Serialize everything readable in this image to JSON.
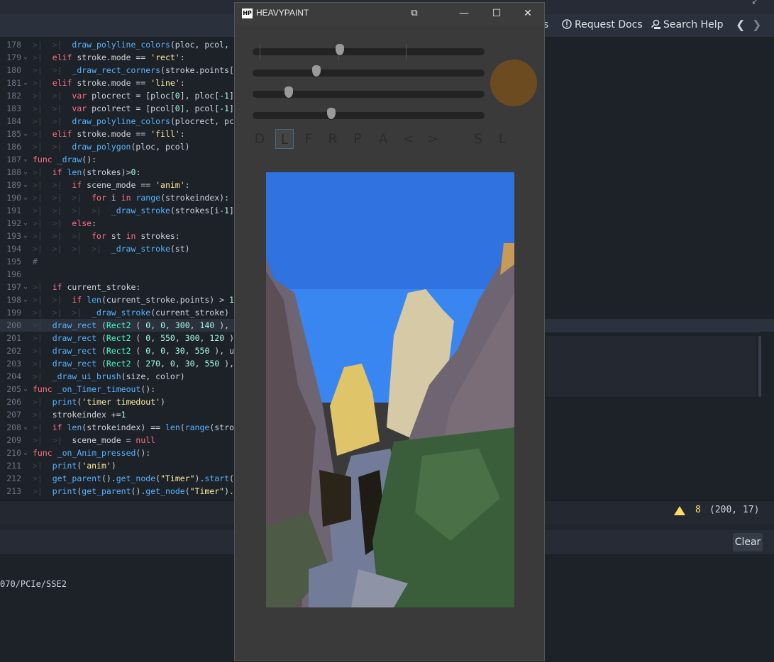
{
  "editor": {
    "toolbar": {
      "partial_label": "s",
      "request_docs": "Request Docs",
      "search_help": "Search Help",
      "prev": "❮",
      "next": "❯"
    },
    "code_lines": [
      {
        "n": "178",
        "fold": "",
        "html": "<span class='t-tab'>&gt;|  &gt;|  </span><span class='t-fn'>draw_polyline_colors</span>(ploc, pcol, "
      },
      {
        "n": "179",
        "fold": "⌄",
        "html": "<span class='t-tab'>&gt;|  </span><span class='t-kw'>elif</span> stroke.mode == <span class='t-str'>'rect'</span>:"
      },
      {
        "n": "180",
        "fold": "",
        "html": "<span class='t-tab'>&gt;|  &gt;|  </span><span class='t-fn'>_draw_rect_corners</span>(stroke.points["
      },
      {
        "n": "181",
        "fold": "⌄",
        "html": "<span class='t-tab'>&gt;|  </span><span class='t-kw'>elif</span> stroke.mode == <span class='t-str'>'line'</span>:"
      },
      {
        "n": "182",
        "fold": "",
        "html": "<span class='t-tab'>&gt;|  &gt;|  </span><span class='t-kw'>var</span> plocrect = [ploc[<span class='t-num'>0</span>], ploc[<span class='t-num'>-1</span>]"
      },
      {
        "n": "183",
        "fold": "",
        "html": "<span class='t-tab'>&gt;|  &gt;|  </span><span class='t-kw'>var</span> pcolrect = [pcol[<span class='t-num'>0</span>], pcol[<span class='t-num'>-1</span>]"
      },
      {
        "n": "184",
        "fold": "",
        "html": "<span class='t-tab'>&gt;|  &gt;|  </span><span class='t-fn'>draw_polyline_colors</span>(plocrect, pc"
      },
      {
        "n": "185",
        "fold": "⌄",
        "html": "<span class='t-tab'>&gt;|  </span><span class='t-kw'>elif</span> stroke.mode == <span class='t-str'>'fill'</span>:"
      },
      {
        "n": "186",
        "fold": "",
        "html": "<span class='t-tab'>&gt;|  &gt;|  </span><span class='t-fn'>draw_polygon</span>(ploc, pcol)"
      },
      {
        "n": "187",
        "fold": "⌄",
        "html": "<span class='t-kw'>func</span> <span class='t-fn'>_draw</span>():"
      },
      {
        "n": "188",
        "fold": "⌄",
        "html": "<span class='t-tab'>&gt;|  </span><span class='t-kw'>if</span> <span class='t-fn'>len</span>(strokes)&gt;<span class='t-num'>0</span>:"
      },
      {
        "n": "189",
        "fold": "⌄",
        "html": "<span class='t-tab'>&gt;|  &gt;|  </span><span class='t-kw'>if</span> scene_mode == <span class='t-str'>'anim'</span>:"
      },
      {
        "n": "190",
        "fold": "⌄",
        "html": "<span class='t-tab'>&gt;|  &gt;|  &gt;|  </span><span class='t-kw'>for</span> i <span class='t-kw'>in</span> <span class='t-fn'>range</span>(strokeindex):"
      },
      {
        "n": "191",
        "fold": "",
        "html": "<span class='t-tab'>&gt;|  &gt;|  &gt;|  &gt;|  </span><span class='t-fn'>_draw_stroke</span>(strokes[i-<span class='t-num'>1</span>]"
      },
      {
        "n": "192",
        "fold": "⌄",
        "html": "<span class='t-tab'>&gt;|  &gt;|  </span><span class='t-kw'>else</span>:"
      },
      {
        "n": "193",
        "fold": "⌄",
        "html": "<span class='t-tab'>&gt;|  &gt;|  &gt;|  </span><span class='t-kw'>for</span> st <span class='t-kw'>in</span> strokes:"
      },
      {
        "n": "194",
        "fold": "",
        "html": "<span class='t-tab'>&gt;|  &gt;|  &gt;|  &gt;|  </span><span class='t-fn'>_draw_stroke</span>(st)"
      },
      {
        "n": "195",
        "fold": "",
        "html": "<span class='t-cm'>#</span>"
      },
      {
        "n": "196",
        "fold": "",
        "html": ""
      },
      {
        "n": "197",
        "fold": "⌄",
        "html": "<span class='t-tab'>&gt;|  </span><span class='t-kw'>if</span> current_stroke:"
      },
      {
        "n": "198",
        "fold": "⌄",
        "html": "<span class='t-tab'>&gt;|  &gt;|  </span><span class='t-kw'>if</span> <span class='t-fn'>len</span>(current_stroke.points) &gt; <span class='t-num'>1</span>"
      },
      {
        "n": "199",
        "fold": "",
        "html": "<span class='t-tab'>&gt;|  &gt;|  &gt;|  </span><span class='t-fn'>_draw_stroke</span>(current_stroke)"
      },
      {
        "n": "200",
        "fold": "",
        "html": "<span class='t-tab'>&gt;|  </span><span class='t-fn'>draw_rect</span> (<span class='t-cls'>Rect2</span> ( <span class='t-num'>0</span>, <span class='t-num'>0</span>, <span class='t-num'>300</span>, <span class='t-num'>140</span> ),",
        "hl": true
      },
      {
        "n": "201",
        "fold": "",
        "html": "<span class='t-tab'>&gt;|  </span><span class='t-fn'>draw_rect</span> (<span class='t-cls'>Rect2</span> ( <span class='t-num'>0</span>, <span class='t-num'>550</span>, <span class='t-num'>300</span>, <span class='t-num'>120</span> ),"
      },
      {
        "n": "202",
        "fold": "",
        "html": "<span class='t-tab'>&gt;|  </span><span class='t-fn'>draw_rect</span> (<span class='t-cls'>Rect2</span> ( <span class='t-num'>0</span>, <span class='t-num'>0</span>, <span class='t-num'>30</span>, <span class='t-num'>550</span> ), u"
      },
      {
        "n": "203",
        "fold": "",
        "html": "<span class='t-tab'>&gt;|  </span><span class='t-fn'>draw_rect</span> (<span class='t-cls'>Rect2</span> ( <span class='t-num'>270</span>, <span class='t-num'>0</span>, <span class='t-num'>30</span>, <span class='t-num'>550</span> ),"
      },
      {
        "n": "204",
        "fold": "",
        "html": "<span class='t-tab'>&gt;|  </span><span class='t-fn'>_draw_ui_brush</span>(size, color)"
      },
      {
        "n": "205",
        "fold": "⌄",
        "html": "<span class='t-kw'>func</span> <span class='t-fn'>_on_Timer_timeout</span>():"
      },
      {
        "n": "206",
        "fold": "",
        "html": "<span class='t-tab'>&gt;|  </span><span class='t-fn'>print</span>(<span class='t-str'>'timer timedout'</span>)"
      },
      {
        "n": "207",
        "fold": "",
        "html": "<span class='t-tab'>&gt;|  </span>strokeindex +=<span class='t-num'>1</span>"
      },
      {
        "n": "208",
        "fold": "⌄",
        "html": "<span class='t-tab'>&gt;|  </span><span class='t-kw'>if</span> <span class='t-fn'>len</span>(strokeindex) == <span class='t-fn'>len</span>(<span class='t-fn'>range</span>(stro"
      },
      {
        "n": "209",
        "fold": "",
        "html": "<span class='t-tab'>&gt;|  &gt;|  </span>scene_mode = <span class='t-kw'>null</span>"
      },
      {
        "n": "210",
        "fold": "⌄",
        "html": "<span class='t-kw'>func</span> <span class='t-fn'>_on_Anim_pressed</span>():"
      },
      {
        "n": "211",
        "fold": "",
        "html": "<span class='t-tab'>&gt;|  </span><span class='t-fn'>print</span>(<span class='t-str'>'anim'</span>)"
      },
      {
        "n": "212",
        "fold": "",
        "html": "<span class='t-tab'>&gt;|  </span><span class='t-fn'>get_parent</span>().<span class='t-fn'>get_node</span>(<span class='t-str'>\"Timer\"</span>).<span class='t-fn'>start</span>("
      },
      {
        "n": "213",
        "fold": "",
        "html": "<span class='t-tab'>&gt;|  </span><span class='t-fn'>print</span>(<span class='t-fn'>get_parent</span>().<span class='t-fn'>get_node</span>(<span class='t-str'>\"Timer\"</span>)."
      }
    ],
    "status": {
      "warning_count": "8",
      "cursor_position": "(200, 17)"
    },
    "output": {
      "clear_label": "Clear",
      "text": "070/PCIe/SSE2"
    }
  },
  "heavypaint": {
    "logo": "HP",
    "title": "HEAVYPAINT",
    "window_buttons": {
      "restore": "⧉",
      "minimize": "—",
      "maximize": "☐",
      "close": "✕"
    },
    "sliders": [
      {
        "name": "slider-1",
        "value": 0.375
      },
      {
        "name": "slider-2",
        "value": 0.275
      },
      {
        "name": "slider-3",
        "value": 0.155
      },
      {
        "name": "slider-4",
        "value": 0.34
      }
    ],
    "brush_color": "#6d4b20",
    "tools": [
      {
        "label": "D",
        "active": false
      },
      {
        "label": "L",
        "active": true
      },
      {
        "label": "F",
        "active": false
      },
      {
        "label": "R",
        "active": false
      },
      {
        "label": "P",
        "active": false
      },
      {
        "label": "A",
        "active": false
      },
      {
        "label": "<",
        "active": false
      },
      {
        "label": ">",
        "active": false
      },
      {
        "label": "S",
        "active": false
      },
      {
        "label": "L",
        "active": false
      }
    ],
    "colors": {
      "sky": "#2f72e0",
      "sky_lower": "#3a86f0",
      "rock": "#6e6472",
      "sand": "#d5c9a6",
      "sunlit": "#e0c46a",
      "foliage": "#3a5e3a",
      "path": "#727c98",
      "shadow": "#2a2419"
    }
  }
}
